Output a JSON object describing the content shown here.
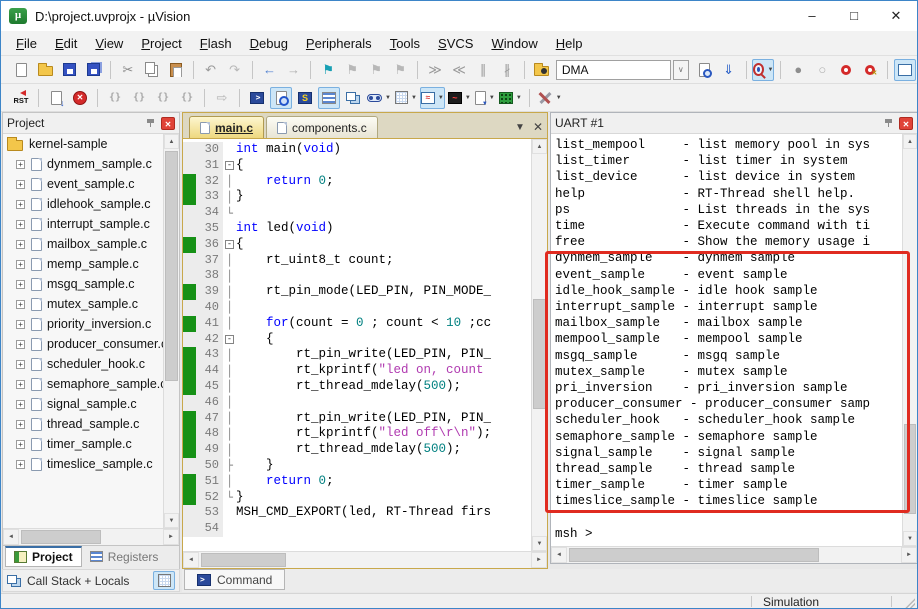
{
  "window": {
    "title": "D:\\project.uvprojx - µVision",
    "controls": {
      "minimize": "–",
      "maximize": "□",
      "close": "✕"
    }
  },
  "menu": {
    "items": [
      "File",
      "Edit",
      "View",
      "Project",
      "Flash",
      "Debug",
      "Peripherals",
      "Tools",
      "SVCS",
      "Window",
      "Help"
    ]
  },
  "toolbar": {
    "dma_value": "DMA",
    "row1": [
      {
        "n": "new-file",
        "t": "page"
      },
      {
        "n": "open-folder",
        "t": "folder"
      },
      {
        "n": "save",
        "t": "floppy"
      },
      {
        "n": "save-all",
        "t": "floppy2"
      },
      {
        "sep": true
      },
      {
        "n": "cut",
        "g": "✂",
        "c": "#8a8a8a"
      },
      {
        "n": "copy",
        "t": "copy"
      },
      {
        "n": "paste",
        "t": "paste"
      },
      {
        "sep": true
      },
      {
        "n": "undo",
        "g": "↶",
        "c": "#9a9a9a"
      },
      {
        "n": "redo",
        "g": "↷",
        "c": "#b8b8b8"
      },
      {
        "sep": true
      },
      {
        "n": "navigate-back",
        "g": "←",
        "c": "#4d7fd0"
      },
      {
        "n": "navigate-forward",
        "g": "→",
        "c": "#b0b0b0"
      },
      {
        "sep": true
      },
      {
        "n": "insert-bookmark",
        "g": "⚑",
        "c": "#18a0b4"
      },
      {
        "n": "goto-next-bookmark",
        "g": "⚑",
        "c": "#b8b8b8"
      },
      {
        "n": "goto-previous-bookmark",
        "g": "⚑",
        "c": "#b8b8b8"
      },
      {
        "n": "clear-all-bookmarks",
        "g": "⚑",
        "c": "#b8b8b8"
      },
      {
        "sep": true
      },
      {
        "n": "indent",
        "g": "≫",
        "c": "#9a9a9a"
      },
      {
        "n": "outdent",
        "g": "≪",
        "c": "#9a9a9a"
      },
      {
        "n": "comment",
        "g": "∥",
        "c": "#9a9a9a"
      },
      {
        "n": "uncomment",
        "g": "∦",
        "c": "#9a9a9a"
      },
      {
        "sep": true
      },
      {
        "n": "find-in-files",
        "t": "folderb"
      },
      {
        "combo": true
      },
      {
        "n": "find-text",
        "t": "pageb"
      },
      {
        "n": "incremental-find",
        "g": "⇓",
        "c": "#2d62c8"
      },
      {
        "sep": true
      },
      {
        "n": "run-to-cursor-line",
        "t": "q",
        "hl": true,
        "dd": true
      },
      {
        "sep": true
      },
      {
        "n": "insert-breakpoint",
        "g": "●",
        "c": "#8e8e8e"
      },
      {
        "n": "enable-disable-breakpoint",
        "g": "○",
        "c": "#b0b0b0"
      },
      {
        "n": "disable-all-breakpoints",
        "t": "donut"
      },
      {
        "n": "kill-all-breakpoints",
        "t": "donutx"
      },
      {
        "sep": true
      },
      {
        "n": "project-window",
        "t": "projwin",
        "hl": true
      }
    ],
    "row2": [
      {
        "n": "reset",
        "t": "rst",
        "g": "RST"
      },
      {
        "sep": true
      },
      {
        "n": "show-next-statement",
        "t": "pagearrow"
      },
      {
        "n": "stop-debug",
        "t": "stop",
        "g": "✕"
      },
      {
        "sep": true
      },
      {
        "n": "step-into",
        "t": "step",
        "g": "{}"
      },
      {
        "n": "step-over",
        "t": "step",
        "g": "{}"
      },
      {
        "n": "step-out",
        "t": "step",
        "g": "{}"
      },
      {
        "n": "run-to-cursor",
        "t": "step",
        "g": "{}"
      },
      {
        "sep": true
      },
      {
        "n": "run",
        "g": "⇨",
        "c": "#b5b5b5"
      },
      {
        "sep": true
      },
      {
        "n": "command-window",
        "t": "console",
        "g": ">"
      },
      {
        "n": "disassembly-window",
        "t": "magdoc",
        "hl": true
      },
      {
        "n": "serial-window-s",
        "t": "swin",
        "g": "S"
      },
      {
        "n": "registers-window",
        "t": "lines",
        "hl": true
      },
      {
        "n": "symbols-window",
        "t": "symbols"
      },
      {
        "n": "watch-window",
        "t": "watch",
        "dd": true
      },
      {
        "n": "memory-window",
        "t": "grid",
        "dd": true
      },
      {
        "n": "serial-windows",
        "t": "serial",
        "g": "≈",
        "hl": true,
        "dd": true
      },
      {
        "n": "logic-analyzer",
        "t": "analyzer",
        "g": "~",
        "dd": true
      },
      {
        "n": "system-viewer",
        "t": "sysv",
        "dd": true
      },
      {
        "n": "toolbox",
        "t": "toolbox",
        "dd": true
      },
      {
        "sep": true
      },
      {
        "n": "configure-tools",
        "t": "tools",
        "dd": true
      }
    ]
  },
  "project_panel": {
    "title": "Project",
    "root_label": "kernel-sample",
    "files": [
      "dynmem_sample.c",
      "event_sample.c",
      "idlehook_sample.c",
      "interrupt_sample.c",
      "mailbox_sample.c",
      "memp_sample.c",
      "msgq_sample.c",
      "mutex_sample.c",
      "priority_inversion.c",
      "producer_consumer.c",
      "scheduler_hook.c",
      "semaphore_sample.c",
      "signal_sample.c",
      "thread_sample.c",
      "timer_sample.c",
      "timeslice_sample.c"
    ]
  },
  "editor": {
    "tabs": [
      {
        "label": "main.c",
        "active": true
      },
      {
        "label": "components.c",
        "active": false
      }
    ],
    "controls": {
      "doc_list": "▼",
      "close": "✕"
    },
    "lines": [
      {
        "n": 30,
        "cov": false,
        "f": "",
        "segs": [
          [
            "kw",
            "int"
          ],
          [
            "pl",
            " main("
          ],
          [
            "kw",
            "void"
          ],
          [
            "pl",
            ")"
          ]
        ]
      },
      {
        "n": 31,
        "cov": false,
        "f": "s",
        "segs": [
          [
            "pl",
            "{"
          ]
        ]
      },
      {
        "n": 32,
        "cov": true,
        "f": "m",
        "segs": [
          [
            "pl",
            "    "
          ],
          [
            "kw",
            "return"
          ],
          [
            "pl",
            " "
          ],
          [
            "num",
            "0"
          ],
          [
            "pl",
            ";"
          ]
        ]
      },
      {
        "n": 33,
        "cov": true,
        "f": "m",
        "segs": [
          [
            "pl",
            "}"
          ]
        ]
      },
      {
        "n": 34,
        "cov": false,
        "f": "e",
        "segs": []
      },
      {
        "n": 35,
        "cov": false,
        "f": "",
        "segs": [
          [
            "kw",
            "int"
          ],
          [
            "pl",
            " led("
          ],
          [
            "kw",
            "void"
          ],
          [
            "pl",
            ")"
          ]
        ]
      },
      {
        "n": 36,
        "cov": true,
        "f": "s",
        "segs": [
          [
            "pl",
            "{"
          ]
        ]
      },
      {
        "n": 37,
        "cov": false,
        "f": "m",
        "segs": [
          [
            "pl",
            "    rt_uint8_t count;"
          ]
        ]
      },
      {
        "n": 38,
        "cov": false,
        "f": "m",
        "segs": []
      },
      {
        "n": 39,
        "cov": true,
        "f": "m",
        "segs": [
          [
            "pl",
            "    rt_pin_mode(LED_PIN, PIN_MODE_"
          ]
        ]
      },
      {
        "n": 40,
        "cov": false,
        "f": "m",
        "segs": []
      },
      {
        "n": 41,
        "cov": true,
        "f": "m",
        "segs": [
          [
            "pl",
            "    "
          ],
          [
            "kw",
            "for"
          ],
          [
            "pl",
            "(count = "
          ],
          [
            "num",
            "0"
          ],
          [
            "pl",
            " ; count < "
          ],
          [
            "num",
            "10"
          ],
          [
            "pl",
            " ;cc"
          ]
        ]
      },
      {
        "n": 42,
        "cov": false,
        "f": "s",
        "segs": [
          [
            "pl",
            "    {"
          ]
        ]
      },
      {
        "n": 43,
        "cov": true,
        "f": "m",
        "segs": [
          [
            "pl",
            "        rt_pin_write(LED_PIN, PIN_"
          ]
        ]
      },
      {
        "n": 44,
        "cov": true,
        "f": "m",
        "segs": [
          [
            "pl",
            "        rt_kprintf("
          ],
          [
            "str",
            "\"led on, count"
          ]
        ]
      },
      {
        "n": 45,
        "cov": true,
        "f": "m",
        "segs": [
          [
            "pl",
            "        rt_thread_mdelay("
          ],
          [
            "num",
            "500"
          ],
          [
            "pl",
            ");"
          ]
        ]
      },
      {
        "n": 46,
        "cov": false,
        "f": "m",
        "segs": []
      },
      {
        "n": 47,
        "cov": true,
        "f": "m",
        "segs": [
          [
            "pl",
            "        rt_pin_write(LED_PIN, PIN_"
          ]
        ]
      },
      {
        "n": 48,
        "cov": true,
        "f": "m",
        "segs": [
          [
            "pl",
            "        rt_kprintf("
          ],
          [
            "str",
            "\"led off\\r\\n\""
          ],
          [
            "pl",
            ");"
          ]
        ]
      },
      {
        "n": 49,
        "cov": true,
        "f": "m",
        "segs": [
          [
            "pl",
            "        rt_thread_mdelay("
          ],
          [
            "num",
            "500"
          ],
          [
            "pl",
            ");"
          ]
        ]
      },
      {
        "n": 50,
        "cov": false,
        "f": "t",
        "segs": [
          [
            "pl",
            "    }"
          ]
        ]
      },
      {
        "n": 51,
        "cov": true,
        "f": "m",
        "segs": [
          [
            "pl",
            "    "
          ],
          [
            "kw",
            "return"
          ],
          [
            "pl",
            " "
          ],
          [
            "num",
            "0"
          ],
          [
            "pl",
            ";"
          ]
        ]
      },
      {
        "n": 52,
        "cov": true,
        "f": "e",
        "segs": [
          [
            "pl",
            "}"
          ]
        ]
      },
      {
        "n": 53,
        "cov": false,
        "f": "",
        "segs": [
          [
            "pl",
            "MSH_CMD_EXPORT(led, RT-Thread firs"
          ]
        ]
      },
      {
        "n": 54,
        "cov": false,
        "f": "",
        "segs": []
      }
    ]
  },
  "uart_panel": {
    "title": "UART #1",
    "lines": [
      "list_mempool     - list memory pool in sys",
      "list_timer       - list timer in system",
      "list_device      - list device in system",
      "help             - RT-Thread shell help.",
      "ps               - List threads in the sys",
      "time             - Execute command with ti",
      "free             - Show the memory usage i",
      "dynmem_sample    - dynmem sample",
      "event_sample     - event sample",
      "idle_hook_sample - idle hook sample",
      "interrupt_sample - interrupt sample",
      "mailbox_sample   - mailbox sample",
      "mempool_sample   - mempool sample",
      "msgq_sample      - msgq sample",
      "mutex_sample     - mutex sample",
      "pri_inversion    - pri_inversion sample",
      "producer_consumer - producer_consumer samp",
      "scheduler_hook   - scheduler_hook sample",
      "semaphore_sample - semaphore sample",
      "signal_sample    - signal sample",
      "thread_sample    - thread sample",
      "timer_sample     - timer sample",
      "timeslice_sample - timeslice sample",
      "",
      "msh >"
    ]
  },
  "bottom": {
    "project_tab": "Project",
    "registers_tab": "Registers",
    "callstack": "Call Stack + Locals",
    "command_tab": "Command"
  },
  "status_bar": {
    "mode": "Simulation"
  },
  "annotation": {
    "highlight_color": "#e02b20"
  },
  "colors": {
    "coverage_green": "#169116",
    "keyword_blue": "#0000ff",
    "number_teal": "#008080",
    "string_purple": "#b03ab0",
    "window_border_blue": "#3d85c8",
    "annotation_red": "#e02b20"
  }
}
